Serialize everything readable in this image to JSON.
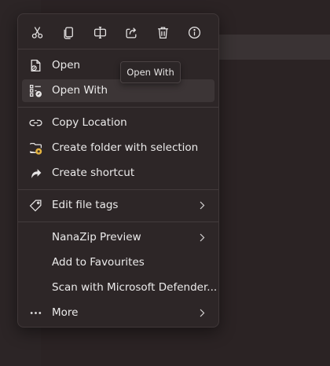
{
  "toolbar": {
    "buttons": [
      {
        "icon": "cut-icon"
      },
      {
        "icon": "copy-icon"
      },
      {
        "icon": "rename-icon"
      },
      {
        "icon": "share-icon"
      },
      {
        "icon": "delete-icon"
      },
      {
        "icon": "info-icon"
      }
    ]
  },
  "menu": {
    "open": "Open",
    "open_with": "Open With",
    "copy_location": "Copy Location",
    "create_folder": "Create folder with selection",
    "create_shortcut": "Create shortcut",
    "edit_tags": "Edit file tags",
    "nanazip": "NanaZip Preview",
    "favourites": "Add to Favourites",
    "defender": "Scan with Microsoft Defender...",
    "more": "More"
  },
  "tooltip": {
    "text": "Open With"
  },
  "colors": {
    "accent_yellow": "#e3b341",
    "menu_bg": "#2d2627",
    "hover_bg": "#3c3536"
  }
}
